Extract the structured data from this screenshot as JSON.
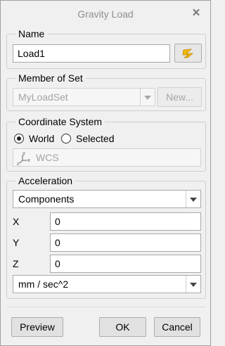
{
  "window": {
    "title": "Gravity Load",
    "close_glyph": "×"
  },
  "name_group": {
    "legend": "Name",
    "value": "Load1",
    "select_icon": "select-entity-icon"
  },
  "member_group": {
    "legend": "Member of Set",
    "selected": "MyLoadSet",
    "new_button": "New..."
  },
  "coord_group": {
    "legend": "Coordinate System",
    "options": [
      "World",
      "Selected"
    ],
    "selected_option": "World",
    "system_value": "WCS",
    "axes_icon": "coordinate-axes-icon"
  },
  "accel_group": {
    "legend": "Acceleration",
    "method": "Components",
    "x_label": "X",
    "x_value": "0",
    "y_label": "Y",
    "y_value": "0",
    "z_label": "Z",
    "z_value": "0",
    "units": "mm / sec^2"
  },
  "buttons": {
    "preview": "Preview",
    "ok": "OK",
    "cancel": "Cancel"
  },
  "colors": {
    "accent_icon": "#f2b800",
    "window_bg": "#f0f0f0"
  }
}
